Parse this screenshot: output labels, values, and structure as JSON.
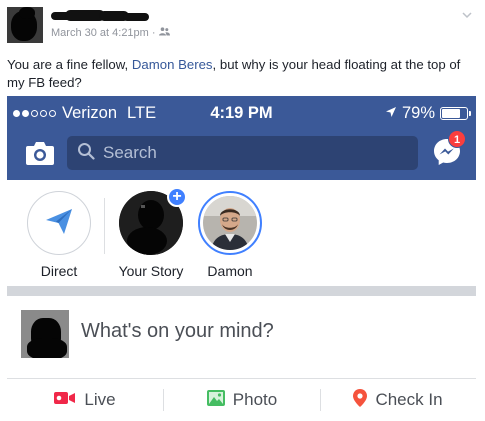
{
  "post": {
    "timestamp": "March 30 at 4:21pm",
    "separator": "·",
    "text_before": "You are a fine fellow, ",
    "mention": "Damon Beres",
    "text_after": ", but why is your head floating at the top of my FB feed?"
  },
  "phone": {
    "status_bar": {
      "carrier": "Verizon",
      "network": "LTE",
      "time": "4:19 PM",
      "battery_percent": "79%",
      "battery_level": 0.79,
      "signal_bars_filled": 2,
      "signal_bars_total": 5
    },
    "header": {
      "search_placeholder": "Search",
      "messenger_badge": "1",
      "brand_color": "#3b5998",
      "badge_color": "#fa3e3e"
    },
    "stories": [
      {
        "label": "Direct"
      },
      {
        "label": "Your Story"
      },
      {
        "label": "Damon"
      }
    ],
    "composer": {
      "prompt": "What's on your mind?"
    },
    "actions": [
      {
        "label": "Live",
        "icon": "live-video-icon",
        "color": "#f02849"
      },
      {
        "label": "Photo",
        "icon": "photo-icon",
        "color": "#45bd62"
      },
      {
        "label": "Check In",
        "icon": "location-pin-icon",
        "color": "#f5533d"
      }
    ]
  }
}
